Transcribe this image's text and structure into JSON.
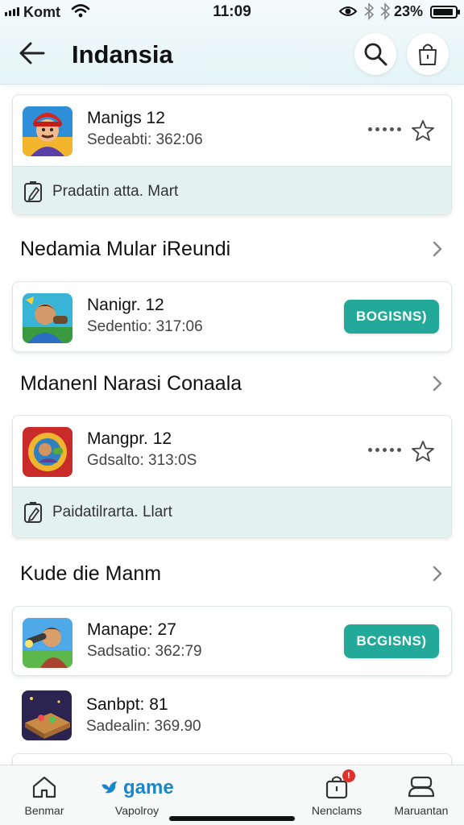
{
  "status_bar": {
    "carrier": "Komt",
    "time": "11:09",
    "battery_percent": "23%"
  },
  "header": {
    "title": "Indansia",
    "back_icon": "arrow-left-icon",
    "search_icon": "search-icon",
    "bag_icon": "shopping-bag-icon"
  },
  "cards": [
    {
      "title": "Manigs 12",
      "subtitle": "Sedeabti: 362:06",
      "note": "Pradatin atta. Mart",
      "note_icon": "edit-note-icon",
      "has_more": true,
      "has_star": true
    },
    {
      "title": "Nanigr. 12",
      "subtitle": "Sedentio: 317:06",
      "action_label": "BOGISNS)"
    },
    {
      "title": "Mangpr. 12",
      "subtitle": "Gdsalto: 313:0S",
      "note": "Paidatilrarta. Llart",
      "note_icon": "edit-note-icon",
      "has_more": true,
      "has_star": true
    },
    {
      "title": "Manape: 27",
      "subtitle": "Sadsatio: 362:79",
      "action_label": "BCGISNS)"
    },
    {
      "title": "Sanbpt: 81",
      "subtitle": "Sadealin: 369.90"
    }
  ],
  "sections": [
    {
      "title": "Nedamia Mular iReundi"
    },
    {
      "title": "Mdanenl Narasi Conaala"
    },
    {
      "title": "Kude die Manm"
    }
  ],
  "bottom_nav": [
    {
      "label": "Benmar",
      "icon": "home-icon"
    },
    {
      "label": "Vapolroy",
      "logo_text": "game",
      "icon": "bird-logo-icon"
    },
    {
      "label": "Nenclams",
      "icon": "bag-icon",
      "badge": "!"
    },
    {
      "label": "Maruantan",
      "icon": "controller-icon"
    }
  ],
  "colors": {
    "accent": "#22a999",
    "header_bg": "#e4f4f5",
    "note_bg": "#e3f2f1",
    "badge": "#e0312b",
    "logo_blue": "#1a86c9"
  }
}
